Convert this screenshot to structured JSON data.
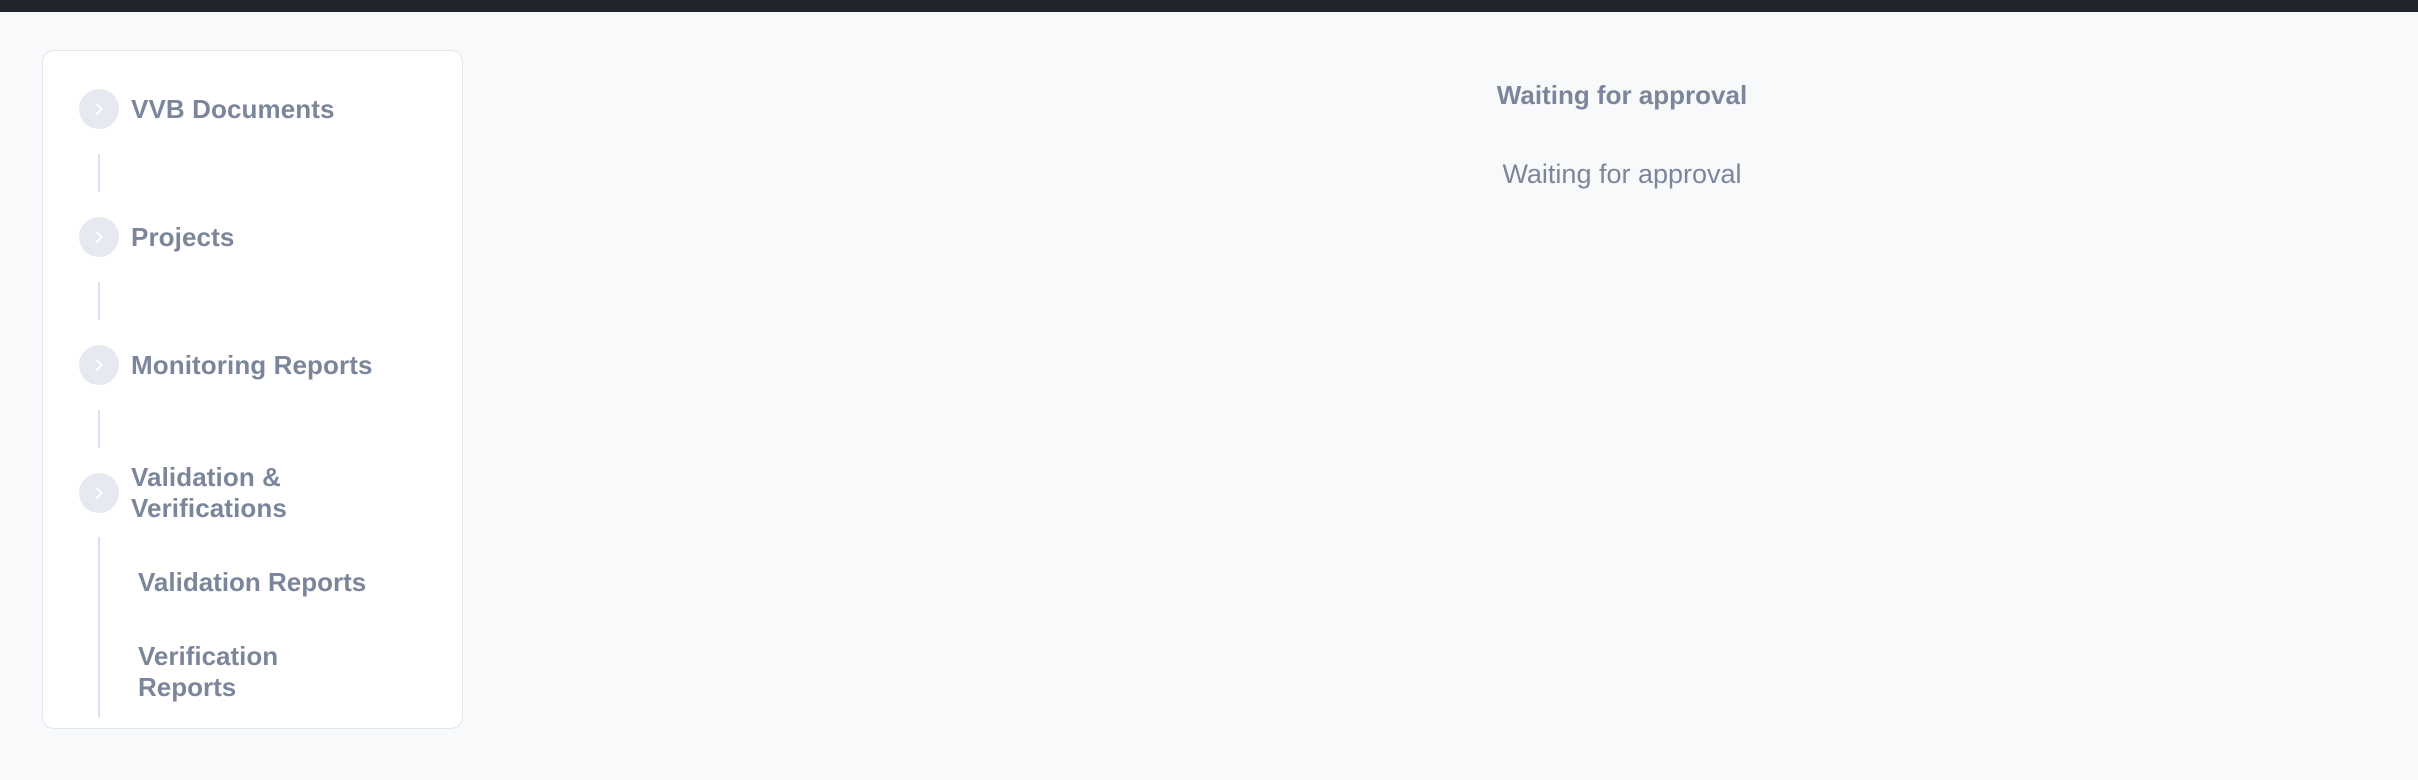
{
  "sidebar": {
    "groups": [
      {
        "label": "VVB Documents",
        "icon": "chevron-right-icon"
      },
      {
        "label": "Projects",
        "icon": "chevron-right-icon"
      },
      {
        "label": "Monitoring Reports",
        "icon": "chevron-right-icon"
      },
      {
        "label": "Validation & Verifications",
        "icon": "chevron-right-icon"
      }
    ],
    "subitems": [
      {
        "label": "Validation Reports"
      },
      {
        "label": "Verification Reports"
      }
    ]
  },
  "main": {
    "title": "Waiting for approval",
    "message": "Waiting for approval"
  },
  "colors": {
    "topbar": "#22242c",
    "background": "#f8f9fb",
    "text": "#7c869b",
    "connector": "#d8e1f2"
  }
}
